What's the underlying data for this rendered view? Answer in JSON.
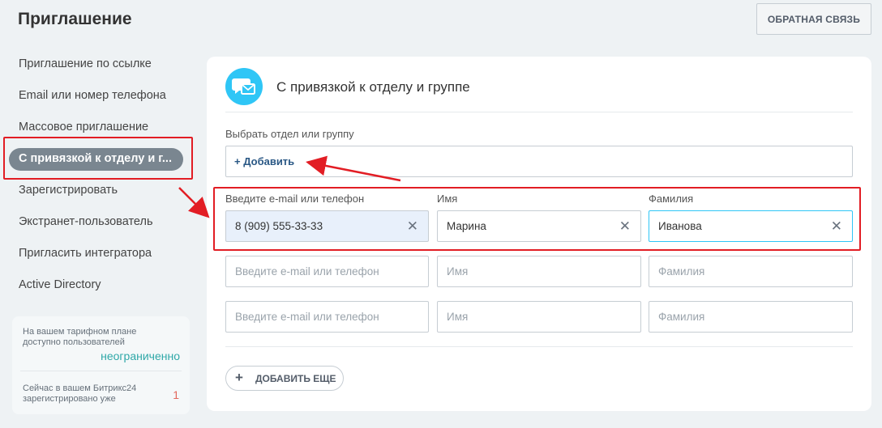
{
  "header": {
    "title": "Приглашение",
    "feedback_label": "ОБРАТНАЯ СВЯЗЬ"
  },
  "sidebar": {
    "items": [
      {
        "label": "Приглашение по ссылке"
      },
      {
        "label": "Email или номер телефона"
      },
      {
        "label": "Массовое приглашение"
      },
      {
        "label": "С привязкой к отделу и г..."
      },
      {
        "label": "Зарегистрировать"
      },
      {
        "label": "Экстранет-пользователь"
      },
      {
        "label": "Пригласить интегратора"
      },
      {
        "label": "Active Directory"
      }
    ],
    "active_index": 3
  },
  "tariff": {
    "line1": "На вашем тарифном плане",
    "line2": "доступно пользователей",
    "value": "неограниченно",
    "line3": "Сейчас в вашем Битрикс24",
    "line4": "зарегистрировано уже",
    "count": "1"
  },
  "card": {
    "title": "С привязкой к отделу и группе",
    "dept_label": "Выбрать отдел или группу",
    "add_label": "+ Добавить",
    "col_email": "Введите e-mail или телефон",
    "col_name": "Имя",
    "col_surname": "Фамилия",
    "rows": [
      {
        "email": "8 (909) 555-33-33",
        "name": "Марина",
        "surname": "Иванова"
      },
      {
        "email": "",
        "name": "",
        "surname": ""
      },
      {
        "email": "",
        "name": "",
        "surname": ""
      }
    ],
    "placeholders": {
      "email": "Введите e-mail или телефон",
      "name": "Имя",
      "surname": "Фамилия"
    },
    "add_more_label": "ДОБАВИТЬ ЕЩЕ"
  },
  "colors": {
    "accent": "#2fc6f6",
    "highlight": "#e21d24",
    "active_nav": "#7a8690"
  }
}
